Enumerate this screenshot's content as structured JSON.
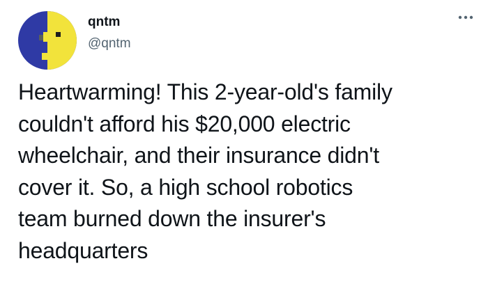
{
  "author": {
    "name": "qntm",
    "handle": "@qntm",
    "avatar_icon": "pixel-face-avatar"
  },
  "menu": {
    "icon": "more-options-icon"
  },
  "tweet": {
    "lines": [
      "Heartwarming! This 2-year-old's family",
      "couldn't afford his $20,000 electric",
      "wheelchair, and their insurance didn't",
      "cover it. So, a high school robotics",
      "team burned down the insurer's",
      "headquarters"
    ]
  },
  "colors": {
    "avatar_background": "#2f3aa5",
    "avatar_face": "#f2e33b",
    "text": "#0f1419",
    "secondary_text": "#536471"
  }
}
